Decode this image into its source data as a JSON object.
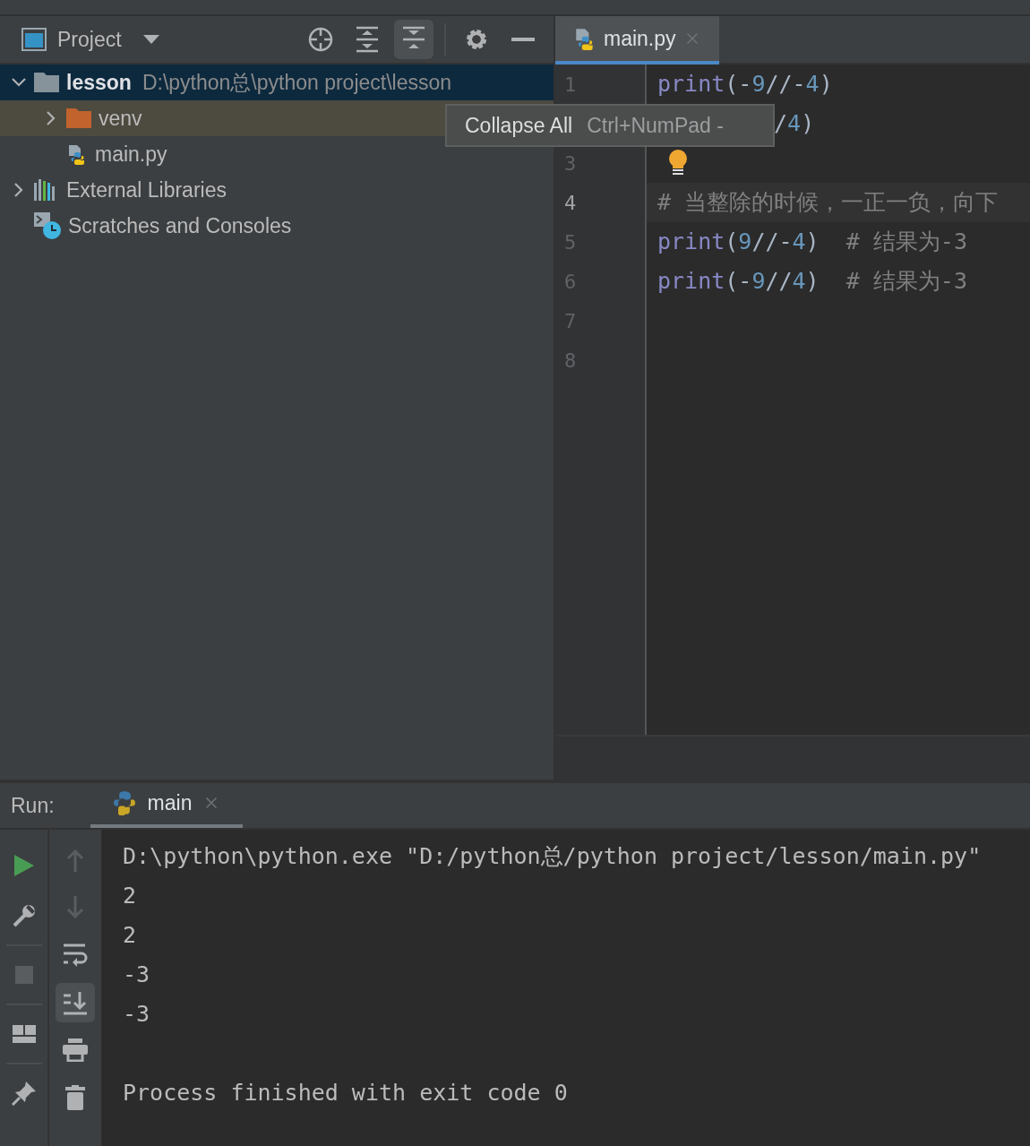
{
  "project_panel": {
    "title": "Project",
    "toolbar": [
      {
        "kind": "locate",
        "pressed": false
      },
      {
        "kind": "expand",
        "pressed": false
      },
      {
        "kind": "collapse",
        "pressed": true
      },
      {
        "kind": "settings",
        "pressed": false
      },
      {
        "kind": "hide",
        "pressed": false
      }
    ],
    "tree": [
      {
        "label": "lesson",
        "hint": "D:\\python总\\python project\\lesson",
        "kind": "folder",
        "expanded": true,
        "selected": true,
        "children": [
          {
            "label": "venv",
            "kind": "excluded-folder",
            "expanded": false,
            "selected": false,
            "highlighted": true
          },
          {
            "label": "main.py",
            "kind": "python-file",
            "selected": false
          }
        ]
      },
      {
        "label": "External Libraries",
        "kind": "libraries",
        "expanded": false,
        "selected": false
      },
      {
        "label": "Scratches and Consoles",
        "kind": "scratches",
        "selected": false
      }
    ]
  },
  "tooltip": {
    "action": "Collapse All",
    "shortcut": "Ctrl+NumPad -"
  },
  "editor": {
    "tabs": [
      {
        "label": "main.py",
        "selected": true
      }
    ],
    "lines": [
      {
        "number": "1",
        "current": false,
        "tokens": [
          {
            "kind": "builtin",
            "text": "print"
          },
          {
            "kind": "op",
            "text": "(-"
          },
          {
            "kind": "number",
            "text": "9"
          },
          {
            "kind": "op",
            "text": "//-"
          },
          {
            "kind": "number",
            "text": "4"
          },
          {
            "kind": "op",
            "text": ")"
          }
        ]
      },
      {
        "tokens": [
          {
            "kind": "op",
            "text": "/"
          },
          {
            "kind": "number",
            "text": "4"
          },
          {
            "kind": "op",
            "text": ")"
          }
        ]
      },
      {
        "number": "3",
        "current": false,
        "bulb": true
      },
      {
        "number": "4",
        "current": true,
        "tokens": [
          {
            "kind": "comment",
            "text": "# 当整除的时候，一正一负，向下"
          }
        ]
      },
      {
        "number": "5",
        "current": false,
        "tokens": [
          {
            "kind": "builtin",
            "text": "print"
          },
          {
            "kind": "op",
            "text": "("
          },
          {
            "kind": "number",
            "text": "9"
          },
          {
            "kind": "op",
            "text": "//-"
          },
          {
            "kind": "number",
            "text": "4"
          },
          {
            "kind": "op",
            "text": ")  "
          },
          {
            "kind": "comment",
            "text": "# 结果为-3"
          }
        ]
      },
      {
        "number": "6",
        "current": false,
        "tokens": [
          {
            "kind": "builtin",
            "text": "print"
          },
          {
            "kind": "op",
            "text": "(-"
          },
          {
            "kind": "number",
            "text": "9"
          },
          {
            "kind": "op",
            "text": "//"
          },
          {
            "kind": "number",
            "text": "4"
          },
          {
            "kind": "op",
            "text": ")  "
          },
          {
            "kind": "comment",
            "text": "# 结果为-3"
          }
        ]
      },
      {
        "number": "7",
        "current": false
      },
      {
        "number": "8",
        "current": false
      }
    ]
  },
  "run_panel": {
    "label": "Run:",
    "tabs": [
      {
        "label": "main",
        "selected": true
      }
    ],
    "side_tools": [
      {
        "kind": "run",
        "disabled": false
      },
      {
        "kind": "wrench",
        "disabled": false
      },
      {
        "kind": "stop",
        "disabled": true
      },
      {
        "kind": "layout",
        "disabled": false
      },
      {
        "kind": "pin",
        "disabled": false
      }
    ],
    "console_tools": [
      {
        "kind": "up",
        "disabled": true,
        "pressed": false
      },
      {
        "kind": "down",
        "disabled": true,
        "pressed": false
      },
      {
        "kind": "wrap",
        "disabled": false,
        "pressed": false
      },
      {
        "kind": "scroll-end",
        "disabled": false,
        "pressed": true
      },
      {
        "kind": "print",
        "disabled": false,
        "pressed": false
      },
      {
        "kind": "trash",
        "disabled": false,
        "pressed": false
      }
    ],
    "console": {
      "command": "D:\\python\\python.exe \"D:/python总/python project/lesson/main.py\"",
      "output": [
        "2",
        "2",
        "-3",
        "-3"
      ],
      "status": "Process finished with exit code 0"
    }
  }
}
